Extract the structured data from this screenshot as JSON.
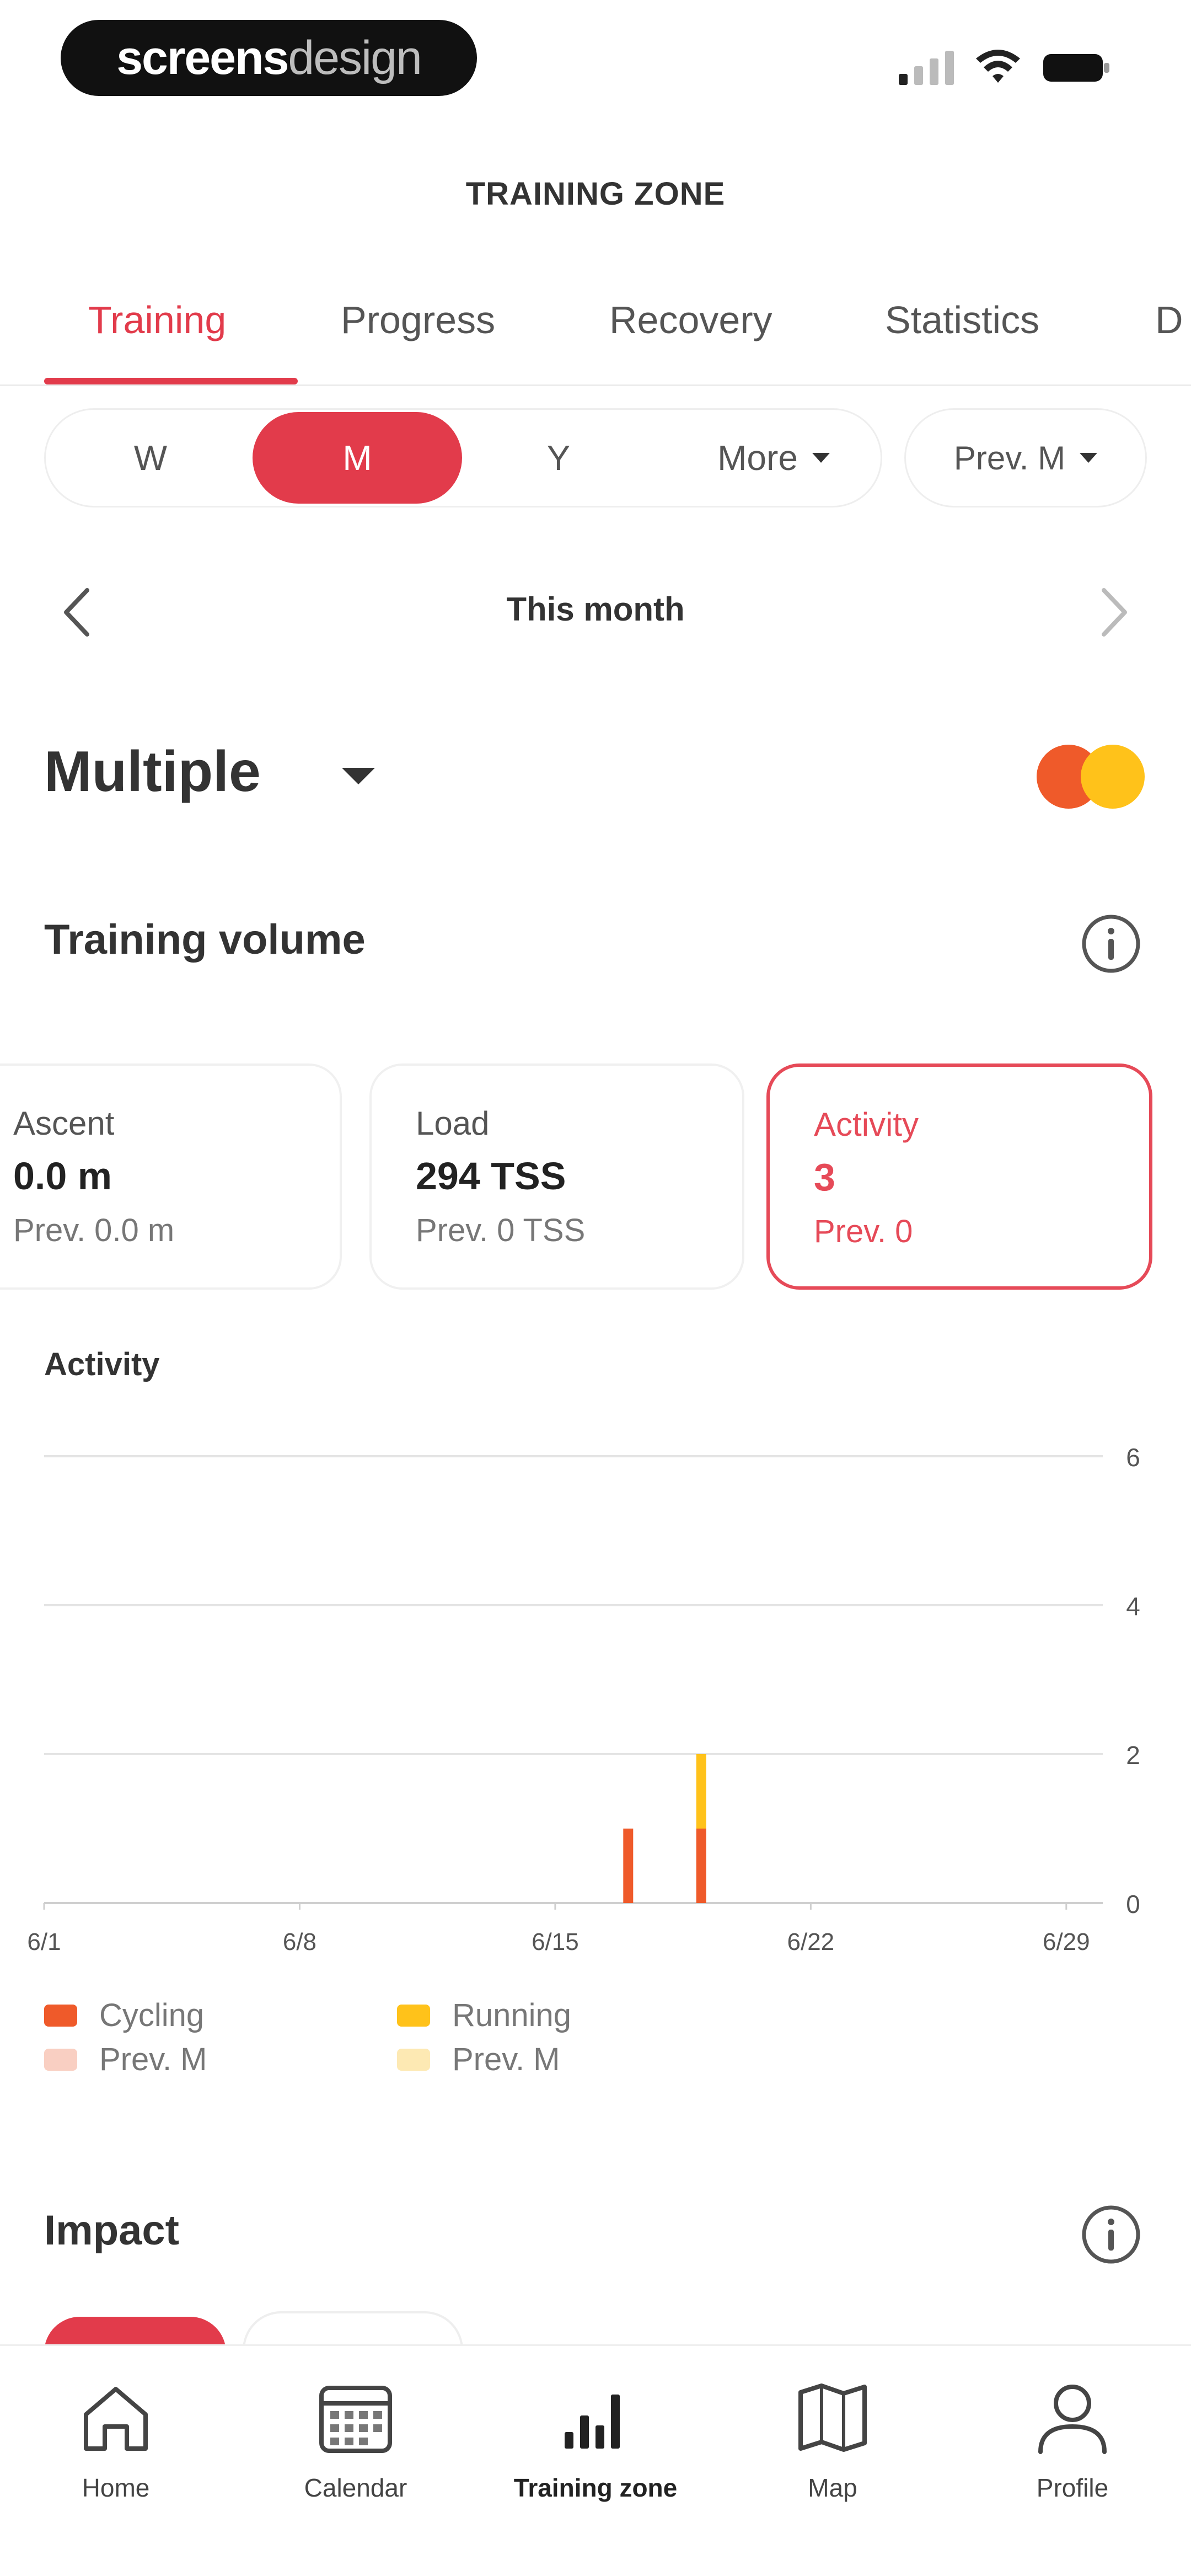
{
  "status_bar": {
    "brand_part1": "screens",
    "brand_part2": "design"
  },
  "header": {
    "title": "TRAINING ZONE"
  },
  "tabs": [
    {
      "label": "Training",
      "active": true
    },
    {
      "label": "Progress"
    },
    {
      "label": "Recovery"
    },
    {
      "label": "Statistics"
    },
    {
      "label": "D"
    }
  ],
  "period": {
    "options": [
      {
        "label": "W"
      },
      {
        "label": "M",
        "active": true
      },
      {
        "label": "Y"
      },
      {
        "label": "More"
      }
    ],
    "compare_label": "Prev. M"
  },
  "range": {
    "label": "This month"
  },
  "sport": {
    "label": "Multiple",
    "icons": [
      "cycling-icon",
      "running-icon"
    ]
  },
  "training_volume": {
    "title": "Training volume",
    "cards": [
      {
        "label": "Ascent",
        "value": "0.0 m",
        "prev": "Prev. 0.0 m"
      },
      {
        "label": "Load",
        "value": "294 TSS",
        "prev": "Prev. 0 TSS"
      },
      {
        "label": "Activity",
        "value": "3",
        "prev": "Prev. 0",
        "selected": true
      }
    ]
  },
  "chart_data": {
    "type": "bar",
    "title": "Activity",
    "x_ticks": [
      "6/1",
      "6/8",
      "6/15",
      "6/22",
      "6/29"
    ],
    "y_ticks": [
      "0",
      "2",
      "4",
      "6"
    ],
    "ylim": [
      0,
      6
    ],
    "xlim": [
      1,
      30
    ],
    "grid": true,
    "series": [
      {
        "name": "Cycling",
        "color": "#ef5a2a",
        "x": [
          17,
          19
        ],
        "values": [
          1,
          1
        ]
      },
      {
        "name": "Running",
        "color": "#ffc21a",
        "x": [
          19
        ],
        "values": [
          1
        ]
      }
    ],
    "stacked": true,
    "legend": [
      {
        "label": "Cycling",
        "color": "#ef5a2a"
      },
      {
        "label": "Prev. M",
        "color": "#f9cfc2"
      },
      {
        "label": "Running",
        "color": "#ffc21a"
      },
      {
        "label": "Prev. M",
        "color": "#fde9b3"
      }
    ]
  },
  "impact": {
    "title": "Impact"
  },
  "bottom_nav": [
    {
      "label": "Home",
      "icon": "home-icon"
    },
    {
      "label": "Calendar",
      "icon": "calendar-icon"
    },
    {
      "label": "Training zone",
      "icon": "bar-chart-icon",
      "active": true
    },
    {
      "label": "Map",
      "icon": "map-icon"
    },
    {
      "label": "Profile",
      "icon": "profile-icon"
    }
  ],
  "colors": {
    "accent": "#e23b4b",
    "cycling": "#ef5a2a",
    "running": "#ffc21a"
  }
}
